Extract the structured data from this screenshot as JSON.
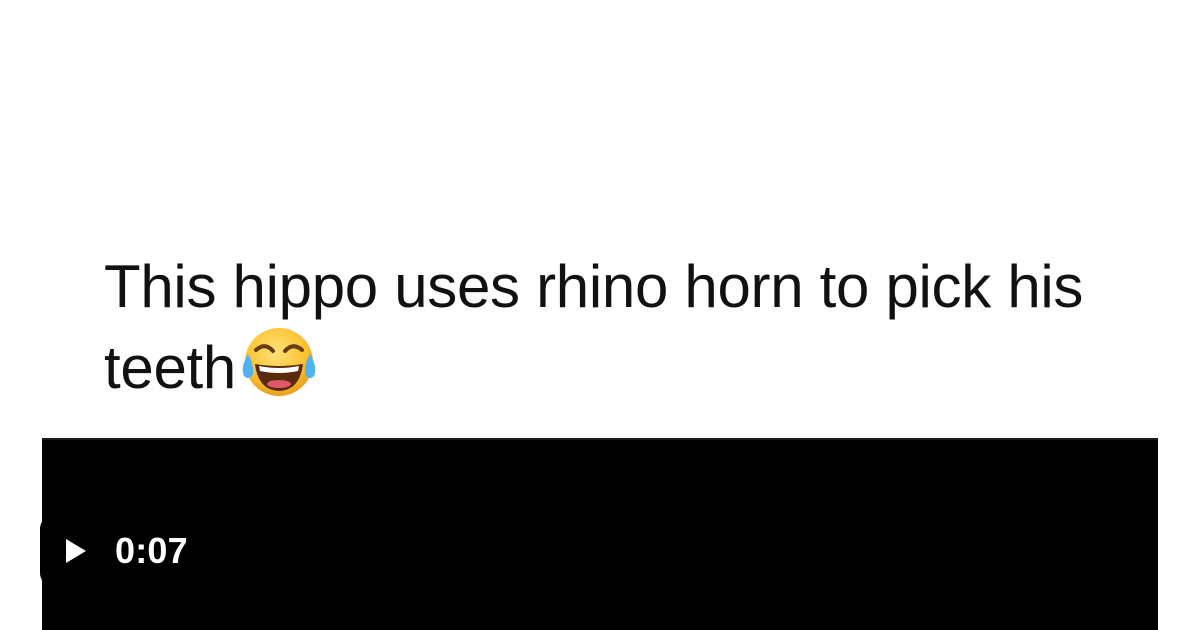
{
  "post": {
    "caption": "This hippo uses rhino horn to pick his teeth",
    "caption_emoji": "face-with-tears-of-joy-icon"
  },
  "video": {
    "duration": "0:07",
    "play_icon": "play-icon",
    "background_color": "#000000"
  }
}
